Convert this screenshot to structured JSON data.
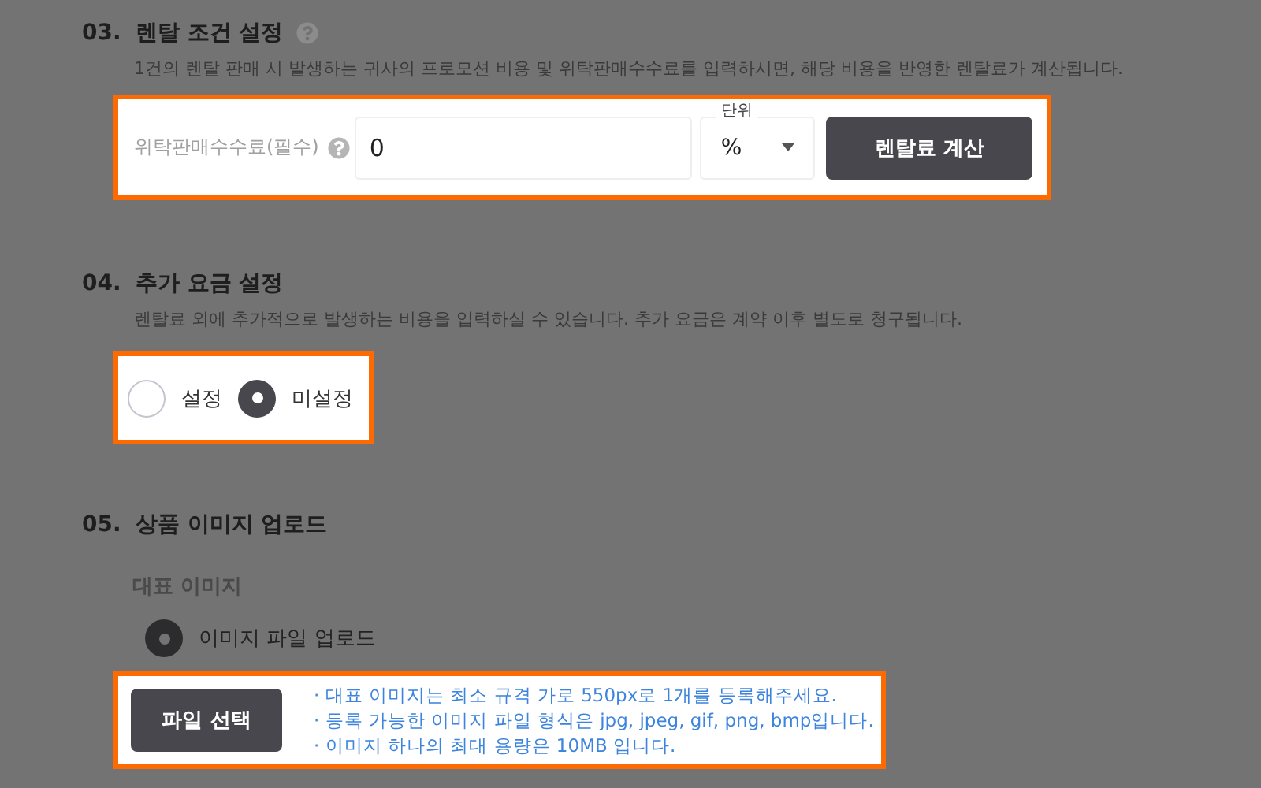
{
  "rental_conditions": {
    "number": "03.",
    "title": "렌탈 조건 설정",
    "description": "1건의 렌탈 판매 시 발생하는 귀사의 프로모션 비용 및 위탁판매수수료를 입력하시면, 해당 비용을 반영한 렌탈료가 계산됩니다.",
    "fee_label": "위탁판매수수료(필수)",
    "fee_value": "0",
    "unit_label": "단위",
    "unit_value": "%",
    "calculate_button": "렌탈료 계산"
  },
  "extra_charges": {
    "number": "04.",
    "title": "추가 요금 설정",
    "description": "렌탈료 외에 추가적으로 발생하는 비용을 입력하실 수 있습니다. 추가 요금은 계약 이후 별도로 청구됩니다.",
    "options": [
      {
        "label": "설정",
        "selected": false
      },
      {
        "label": "미설정",
        "selected": true
      }
    ]
  },
  "image_upload": {
    "number": "05.",
    "title": "상품 이미지 업로드",
    "subtitle": "대표 이미지",
    "options": [
      {
        "label": "이미지 파일 업로드",
        "selected": true
      }
    ],
    "file_button": "파일 선택",
    "notes": [
      "· 대표 이미지는 최소 규격 가로 550px로 1개를 등록해주세요.",
      "· 등록 가능한 이미지 파일 형식은 jpg, jpeg, gif, png, bmp입니다.",
      "· 이미지 하나의 최대 용량은 10MB 입니다."
    ]
  }
}
